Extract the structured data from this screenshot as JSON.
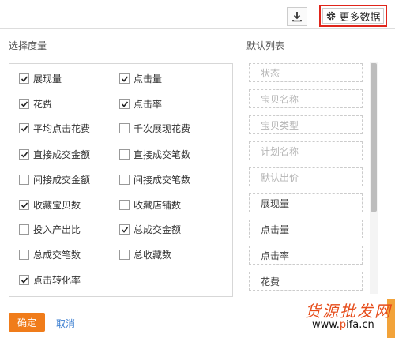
{
  "toolbar": {
    "download_icon": "download-icon",
    "more_data_label": "更多数据",
    "gear_icon": "gear-icon"
  },
  "left": {
    "title": "选择度量",
    "items": [
      {
        "label": "展现量",
        "checked": true
      },
      {
        "label": "点击量",
        "checked": true
      },
      {
        "label": "花费",
        "checked": true
      },
      {
        "label": "点击率",
        "checked": true
      },
      {
        "label": "平均点击花费",
        "checked": true
      },
      {
        "label": "千次展现花费",
        "checked": false
      },
      {
        "label": "直接成交金额",
        "checked": true
      },
      {
        "label": "直接成交笔数",
        "checked": false
      },
      {
        "label": "间接成交金额",
        "checked": false
      },
      {
        "label": "间接成交笔数",
        "checked": false
      },
      {
        "label": "收藏宝贝数",
        "checked": true
      },
      {
        "label": "收藏店铺数",
        "checked": false
      },
      {
        "label": "投入产出比",
        "checked": false
      },
      {
        "label": "总成交金额",
        "checked": true
      },
      {
        "label": "总成交笔数",
        "checked": false
      },
      {
        "label": "总收藏数",
        "checked": false
      },
      {
        "label": "点击转化率",
        "checked": true
      }
    ]
  },
  "right": {
    "title": "默认列表",
    "slots": [
      {
        "label": "状态",
        "disabled": true
      },
      {
        "label": "宝贝名称",
        "disabled": true
      },
      {
        "label": "宝贝类型",
        "disabled": true
      },
      {
        "label": "计划名称",
        "disabled": true
      },
      {
        "label": "默认出价",
        "disabled": true
      },
      {
        "label": "展现量",
        "disabled": false
      },
      {
        "label": "点击量",
        "disabled": false
      },
      {
        "label": "点击率",
        "disabled": false
      },
      {
        "label": "花费",
        "disabled": false
      }
    ]
  },
  "footer": {
    "confirm_label": "确定",
    "cancel_label": "取消"
  },
  "watermark": {
    "top_text": "货源批发网",
    "bottom_prefix": "www.",
    "bottom_p": "p",
    "bottom_suffix": "ifa.cn"
  },
  "colors": {
    "confirm": "#f07c1a",
    "link": "#3d7fd1",
    "highlight_border": "#e0251b"
  }
}
